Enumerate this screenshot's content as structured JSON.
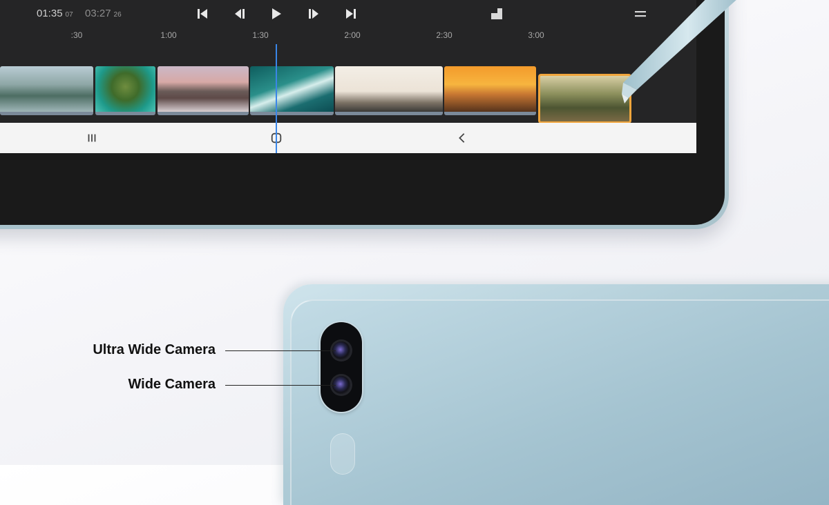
{
  "player": {
    "current_time": "01:35",
    "current_frames": "07",
    "total_time": "03:27",
    "total_frames": "26"
  },
  "ruler": {
    "ticks": [
      ":30",
      "1:00",
      "1:30",
      "2:00",
      "2:30",
      "3:00"
    ]
  },
  "timeline": {
    "clip_subjects": [
      "mountain-lake",
      "aerial-island",
      "kirkjufell-mountain",
      "ocean-waves",
      "surfer-wave",
      "sunset-surfer",
      "forest-sunlight"
    ],
    "selected_clip_index": 6
  },
  "icons": {
    "skip_start": "skip-to-start-icon",
    "step_back": "step-back-icon",
    "play": "play-icon",
    "step_forward": "step-forward-icon",
    "skip_end": "skip-to-end-icon",
    "aspect": "aspect-ratio-icon",
    "menu": "menu-icon",
    "recents": "recents-icon",
    "home": "home-icon",
    "back": "back-icon"
  },
  "callouts": {
    "ultra_wide": "Ultra Wide Camera",
    "wide": "Wide Camera"
  },
  "colors": {
    "screen_bg": "#252526",
    "playhead": "#3a86e8",
    "selection": "#f0a53c",
    "tablet_body": "#aecbd6"
  }
}
